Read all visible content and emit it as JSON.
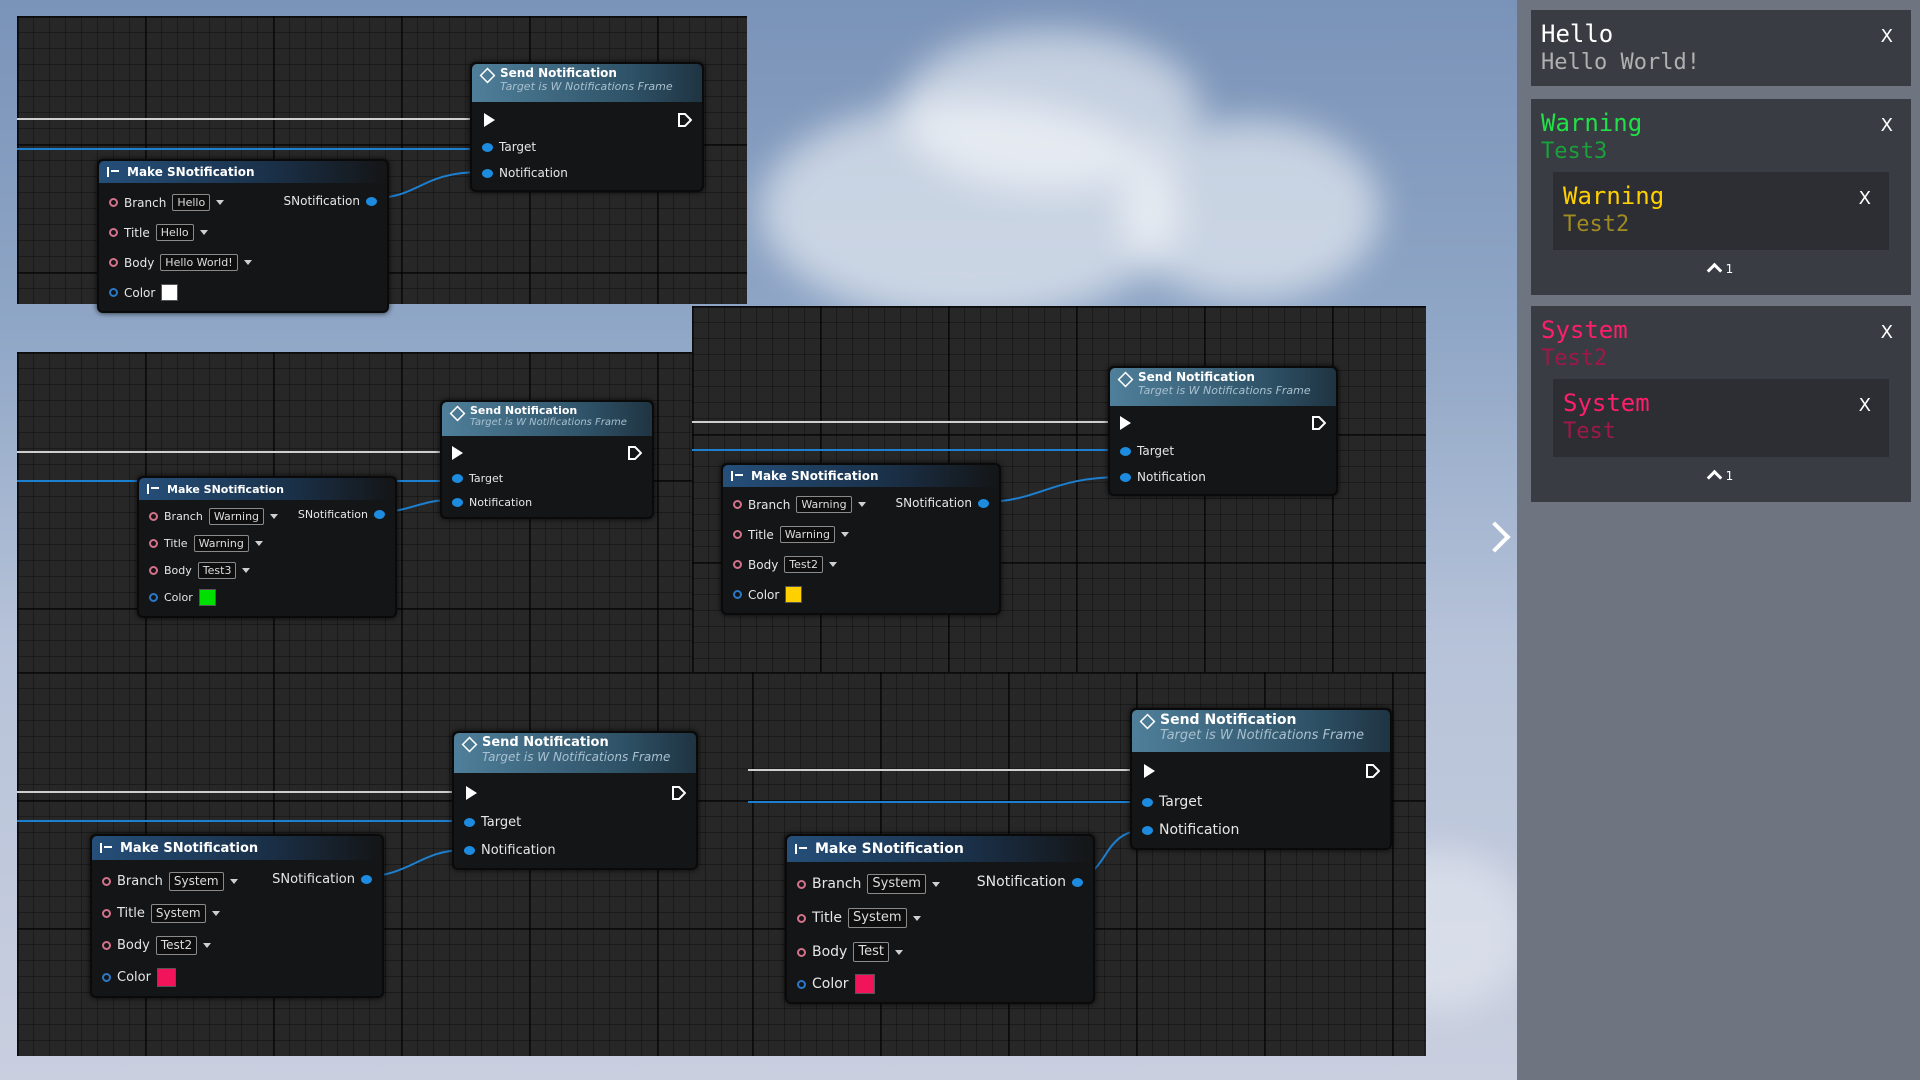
{
  "pin_labels": {
    "branch": "Branch",
    "title": "Title",
    "body": "Body",
    "color": "Color",
    "target": "Target",
    "notification": "Notification",
    "out": "SNotification"
  },
  "make_node_title": "Make SNotification",
  "send_node": {
    "title": "Send Notification",
    "subtitle": "Target is W Notifications Frame"
  },
  "graphs": [
    {
      "branch": "Hello",
      "title": "Hello",
      "body": "Hello World!",
      "color": "#ffffff"
    },
    {
      "branch": "Warning",
      "title": "Warning",
      "body": "Test3",
      "color": "#00e000"
    },
    {
      "branch": "Warning",
      "title": "Warning",
      "body": "Test2",
      "color": "#ffd000"
    },
    {
      "branch": "System",
      "title": "System",
      "body": "Test2",
      "color": "#f2145a"
    },
    {
      "branch": "System",
      "title": "System",
      "body": "Test",
      "color": "#f2145a"
    }
  ],
  "notifications": [
    {
      "title": "Hello",
      "body": "Hello World!",
      "close": "X",
      "color": "#ffffff",
      "body_color": "#b0b0b0"
    },
    {
      "title": "Warning",
      "body": "Test3",
      "close": "X",
      "color": "#22e048",
      "body_color": "#1aa03c",
      "stack": {
        "title": "Warning",
        "body": "Test2",
        "close": "X",
        "color": "#ffd000",
        "body_color": "#a08a22",
        "count": "1"
      }
    },
    {
      "title": "System",
      "body": "Test2",
      "close": "X",
      "color": "#ff1e6a",
      "body_color": "#a01848",
      "stack": {
        "title": "System",
        "body": "Test",
        "close": "X",
        "color": "#ff1e6a",
        "body_color": "#a01848",
        "count": "1"
      }
    }
  ]
}
